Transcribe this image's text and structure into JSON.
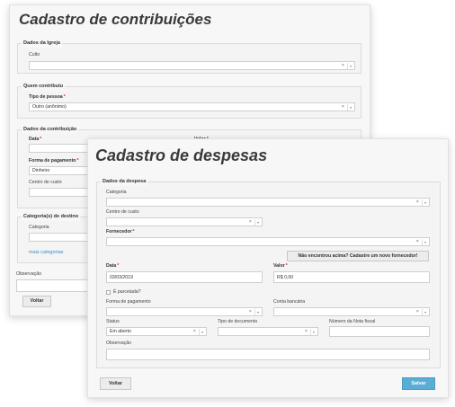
{
  "back": {
    "title": "Cadastro de contribuições",
    "igreja": {
      "legend": "Dados da Igreja",
      "culto_label": "Culto"
    },
    "quem": {
      "legend": "Quem contribuiu",
      "tipo_label": "Tipo de pessoa",
      "tipo_value": "Outro (anônimo)"
    },
    "contrib": {
      "legend": "Dados da contribuição",
      "data_label": "Data",
      "valor_label": "Valor",
      "forma_label": "Forma de pagamento",
      "forma_value": "Dinheiro",
      "centro_label": "Centro de custo"
    },
    "categoria": {
      "legend": "Categoria(s) de destino",
      "categoria_label": "Categoria",
      "mais_link": "mais categorias"
    },
    "observacao_label": "Observação",
    "voltar_label": "Voltar"
  },
  "front": {
    "title": "Cadastro de despesas",
    "legend": "Dados da despesa",
    "categoria_label": "Categoria",
    "centro_label": "Centro de custo",
    "fornecedor_label": "Fornecedor",
    "novo_fornecedor_label": "Não encontrou acima? Cadastre um novo fornecedor!",
    "data_label": "Data",
    "data_value": "03/03/2019",
    "valor_label": "Valor",
    "valor_value": "R$ 0,00",
    "parcelada_label": "É parcelada?",
    "forma_label": "Forma de pagamento",
    "conta_label": "Conta bancária",
    "status_label": "Status",
    "status_value": "Em aberto",
    "tipo_doc_label": "Tipo de documento",
    "nota_label": "Número da Nota fiscal",
    "observacao_label": "Observação",
    "voltar_label": "Voltar",
    "salvar_label": "Salvar"
  },
  "glyphs": {
    "clear": "×",
    "caret": "▾",
    "required": "*"
  },
  "colors": {
    "salvar_bg": "#5aaed6",
    "link": "#3a8fc8",
    "required": "#dd2233"
  }
}
